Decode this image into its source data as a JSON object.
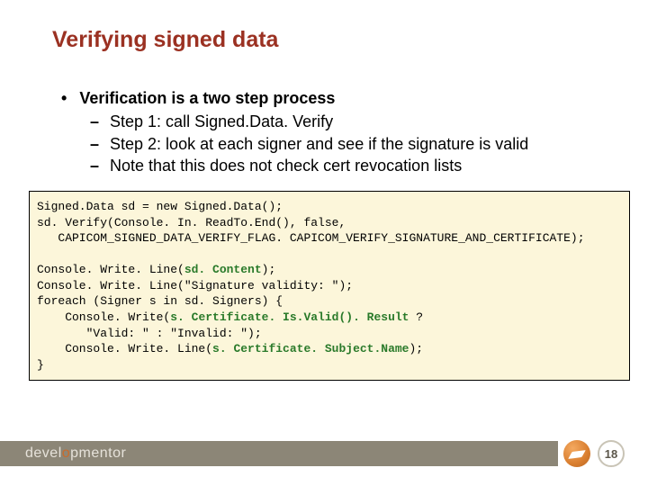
{
  "title": "Verifying signed data",
  "heading": "Verification is a two step process",
  "sub_items": [
    "Step 1: call Signed.Data. Verify",
    "Step 2: look at each signer and see if the signature is valid",
    "Note that this does not check cert revocation lists"
  ],
  "code": {
    "l1": "Signed.Data sd = new Signed.Data();",
    "l2": "sd. Verify(Console. In. ReadTo.End(), false,",
    "l3": "   CAPICOM_SIGNED_DATA_VERIFY_FLAG. CAPICOM_VERIFY_SIGNATURE_AND_CERTIFICATE);",
    "l4": "",
    "l5a": "Console. Write. Line(",
    "l5b": "sd. Content",
    "l5c": ");",
    "l6": "Console. Write. Line(\"Signature validity: \");",
    "l7": "foreach (Signer s in sd. Signers) {",
    "l8a": "    Console. Write(",
    "l8b": "s. Certificate. Is.Valid(). Result",
    "l8c": " ?",
    "l9": "       \"Valid: \" : \"Invalid: \");",
    "l10a": "    Console. Write. Line(",
    "l10b": "s. Certificate. Subject.Name",
    "l10c": ");",
    "l11": "}"
  },
  "brand": {
    "prefix": "devel",
    "o": "o",
    "suffix": "pmentor"
  },
  "page_number": "18"
}
